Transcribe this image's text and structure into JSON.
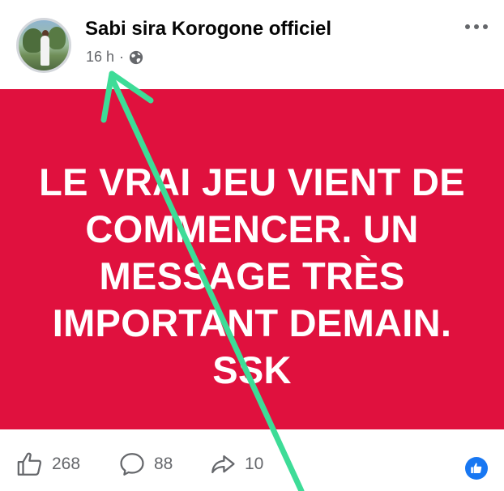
{
  "post": {
    "author": "Sabi sira Korogone officiel",
    "time": "16 h",
    "separator": "·",
    "audience_icon": "globe-icon",
    "more_icon": "more-options-icon"
  },
  "card": {
    "background_color": "#e0113e",
    "lines": [
      "LE VRAI JEU VIENT DE",
      "COMMENCER. UN",
      "MESSAGE TRÈS",
      "IMPORTANT DEMAIN.",
      "SSK"
    ]
  },
  "footer": {
    "likes": "268",
    "comments": "88",
    "shares": "10",
    "reaction_icon": "like-reaction-icon"
  },
  "annotation": {
    "arrow_color": "#3ddc97",
    "arrow_icon": "green-arrow-pointing-to-timestamp"
  }
}
